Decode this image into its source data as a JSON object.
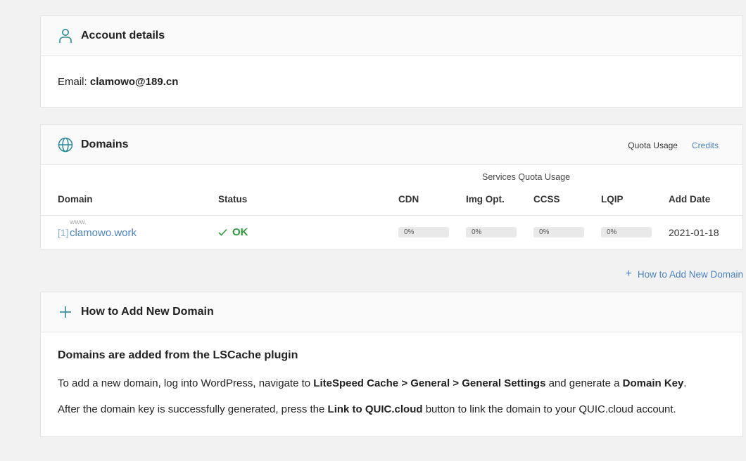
{
  "account": {
    "title": "Account details",
    "email_label": "Email:",
    "email_value": "clamowo@189.cn"
  },
  "domains": {
    "title": "Domains",
    "header_links": [
      "Quota Usage",
      "Credits"
    ],
    "quota_caption": "Services Quota Usage",
    "columns": [
      "Domain",
      "Status",
      "CDN",
      "Img Opt.",
      "CCSS",
      "LQIP",
      "Add Date"
    ],
    "rows": [
      {
        "prefix": "www.",
        "index": "[1]",
        "domain": "clamowo.work",
        "status": "OK",
        "cdn": "0%",
        "img_opt": "0%",
        "ccss": "0%",
        "lqip": "0%",
        "add_date": "2021-01-18"
      }
    ]
  },
  "add_domain_link": "How to Add New Domain",
  "howto": {
    "title": "How to Add New Domain",
    "heading": "Domains are added from the LSCache plugin",
    "p1_a": "To add a new domain, log into WordPress, navigate to ",
    "p1_b": "LiteSpeed Cache > General > General Settings",
    "p1_c": " and generate a ",
    "p1_d": "Domain Key",
    "p1_e": ".",
    "p2_a": "After the domain key is successfully generated, press the ",
    "p2_b": "Link to QUIC.cloud",
    "p2_c": " button to link the domain to your QUIC.cloud account."
  },
  "colors": {
    "accent": "#2b8a9a",
    "link": "#4a83c7",
    "ok": "#2e9a3e"
  },
  "icons": [
    "user-icon",
    "globe-icon",
    "plus-icon",
    "check-icon"
  ]
}
